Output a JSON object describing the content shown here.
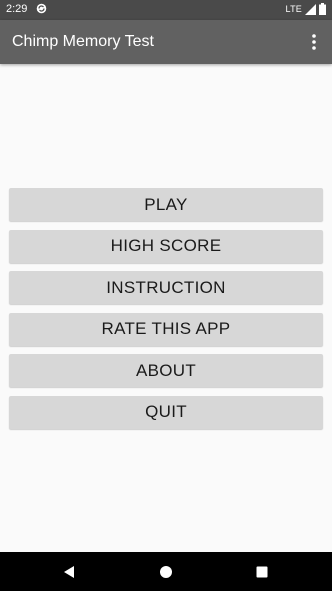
{
  "status_bar": {
    "time": "2:29",
    "network": "LTE"
  },
  "app_bar": {
    "title": "Chimp Memory Test"
  },
  "menu": {
    "buttons": [
      {
        "label": "PLAY"
      },
      {
        "label": "HIGH SCORE"
      },
      {
        "label": "INSTRUCTION"
      },
      {
        "label": "RATE THIS APP"
      },
      {
        "label": "ABOUT"
      },
      {
        "label": "QUIT"
      }
    ]
  },
  "colors": {
    "status_bar": "#4a4a4a",
    "app_bar": "#616161",
    "background": "#fafafa",
    "button": "#d7d7d7",
    "nav_bar": "#000000"
  },
  "icons": {
    "status": [
      "sync-icon",
      "signal-icon",
      "battery-icon"
    ],
    "app_bar": [
      "overflow-menu-icon"
    ],
    "nav": [
      "back-icon",
      "home-icon",
      "recents-icon"
    ]
  }
}
